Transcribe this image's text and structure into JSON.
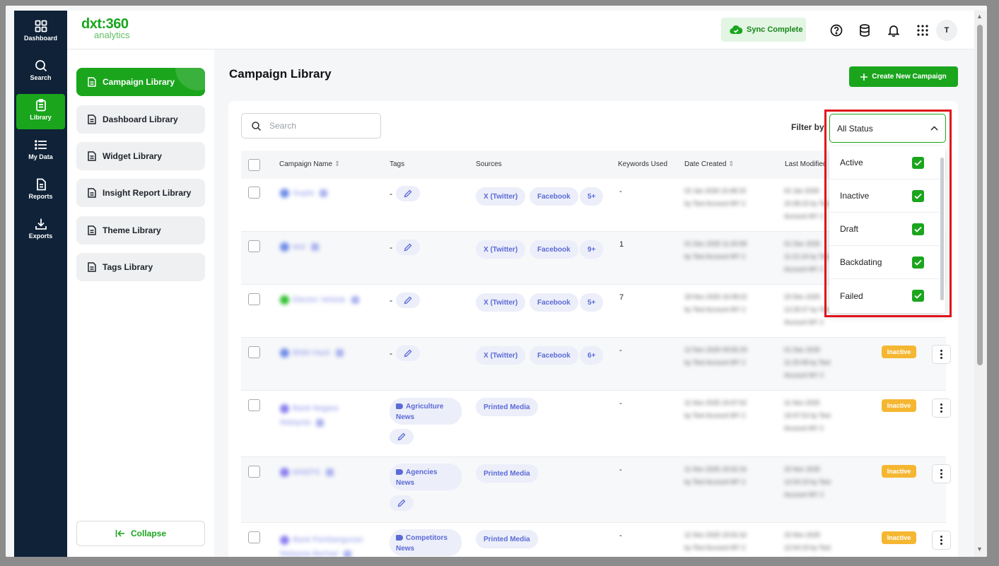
{
  "rail": [
    {
      "label": "Dashboard",
      "icon": "grid-icon"
    },
    {
      "label": "Search",
      "icon": "search-icon"
    },
    {
      "label": "Library",
      "icon": "clipboard-icon"
    },
    {
      "label": "My Data",
      "icon": "list-icon"
    },
    {
      "label": "Reports",
      "icon": "report-icon"
    },
    {
      "label": "Exports",
      "icon": "download-icon"
    }
  ],
  "logo": {
    "main": "dxt:360",
    "sub": "analytics"
  },
  "header": {
    "sync_label": "Sync Complete",
    "avatar_initial": "T"
  },
  "library_menu": [
    "Campaign Library",
    "Dashboard Library",
    "Widget Library",
    "Insight Report Library",
    "Theme Library",
    "Tags Library"
  ],
  "collapse_label": "Collapse",
  "main": {
    "title": "Campaign Library",
    "create_label": "Create New Campaign",
    "search_placeholder": "Search",
    "filter_label": "Filter by"
  },
  "table": {
    "columns": [
      "Campaign Name",
      "Tags",
      "Sources",
      "Keywords Used",
      "Date Created",
      "Last Modified"
    ],
    "rows": [
      {
        "tags_dash": "-",
        "sources": [
          "X (Twitter)",
          "Facebook",
          "5+"
        ],
        "keywords": "-"
      },
      {
        "tags_dash": "-",
        "sources": [
          "X (Twitter)",
          "Facebook",
          "9+"
        ],
        "keywords": "1"
      },
      {
        "tags_dash": "-",
        "sources": [
          "X (Twitter)",
          "Facebook",
          "5+"
        ],
        "keywords": "7"
      },
      {
        "tags_dash": "-",
        "sources": [
          "X (Twitter)",
          "Facebook",
          "6+"
        ],
        "keywords": "-",
        "status": "Inactive"
      },
      {
        "tag": "Agriculture News",
        "sources": [
          "Printed Media"
        ],
        "keywords": "-",
        "status": "Inactive"
      },
      {
        "tag": "Agencies News",
        "sources": [
          "Printed Media"
        ],
        "keywords": "-",
        "status": "Inactive"
      },
      {
        "tag": "Competitors News",
        "sources": [
          "Printed Media"
        ],
        "keywords": "-",
        "status": "Inactive"
      }
    ]
  },
  "status_filter": {
    "selected": "All Status",
    "options": [
      {
        "label": "Active",
        "checked": true
      },
      {
        "label": "Inactive",
        "checked": true
      },
      {
        "label": "Draft",
        "checked": true
      },
      {
        "label": "Backdating",
        "checked": true
      },
      {
        "label": "Failed",
        "checked": true
      }
    ]
  },
  "colors": {
    "brand_green": "#1aa51d",
    "nav_navy": "#0f2238",
    "chip_text": "#5b6bd6",
    "inactive_badge": "#f5b731",
    "highlight_red": "#e0141b"
  }
}
